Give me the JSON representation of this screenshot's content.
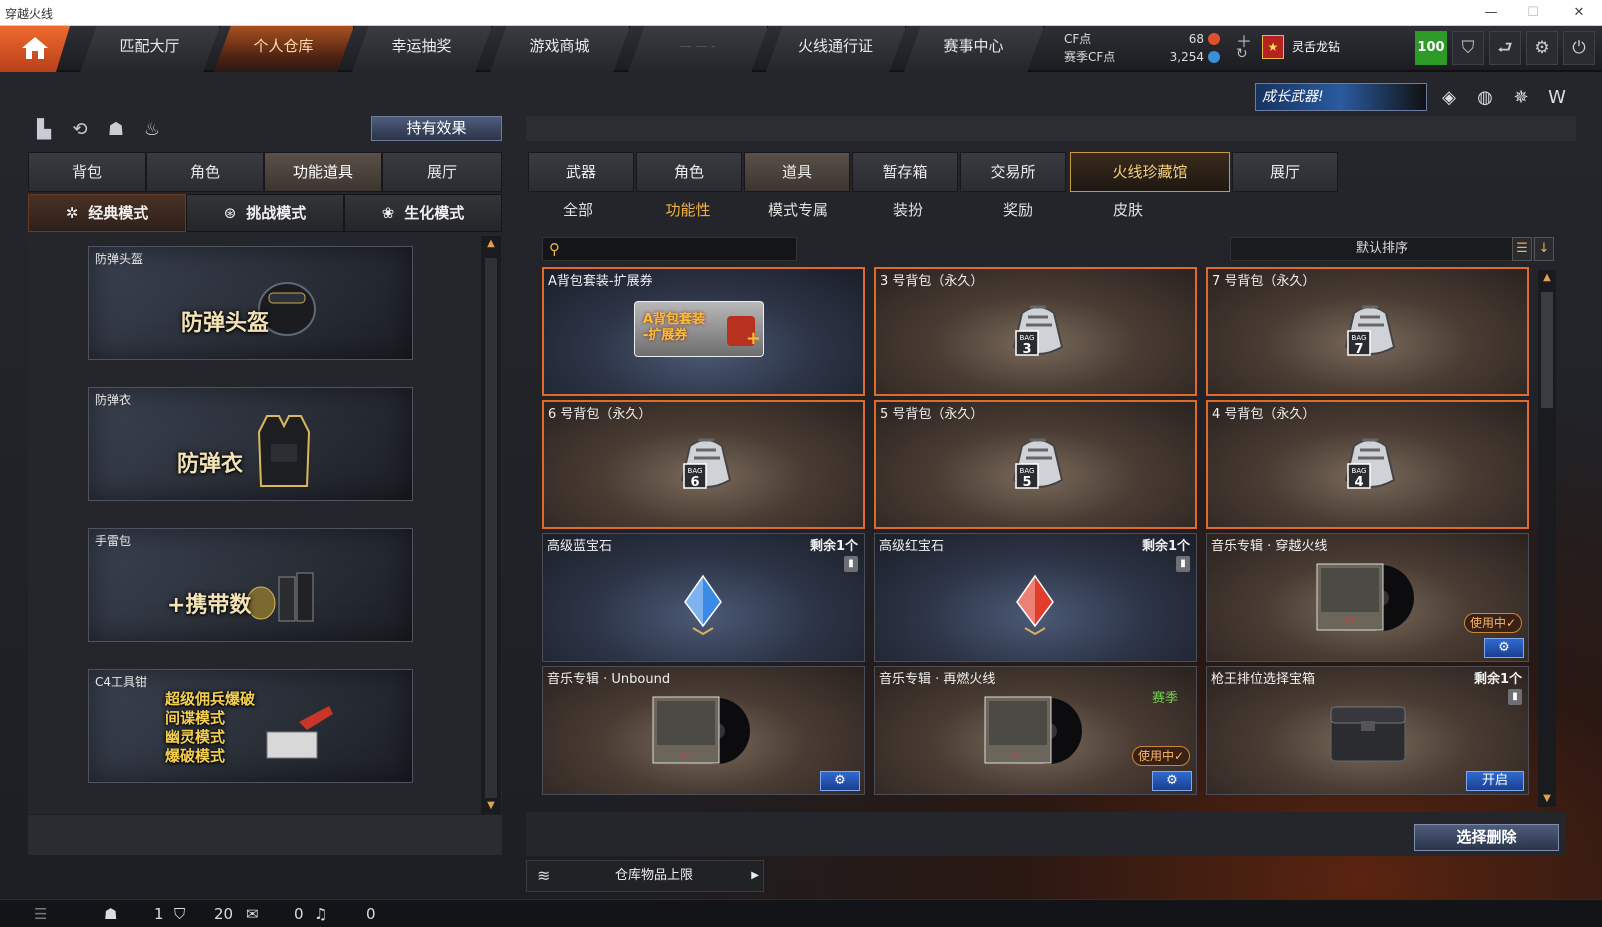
{
  "window": {
    "title": "穿越火线",
    "min": "—",
    "max": "☐",
    "close": "✕"
  },
  "nav": {
    "tabs": [
      "匹配大厅",
      "个人仓库",
      "幸运抽奖",
      "游戏商城",
      "— — -",
      "火线通行证",
      "赛事中心"
    ],
    "cf_label": "CF点",
    "cf_value": "68",
    "season_label": "赛季CF点",
    "season_value": "3,254",
    "username": "灵舌龙钻",
    "rank_icon": "rank-badge",
    "level": "100"
  },
  "effects_button": "持有效果",
  "banner_text": "成长武器!",
  "left": {
    "tabs": [
      "背包",
      "角色",
      "功能道具",
      "展厅"
    ],
    "active_tab": 2,
    "modes": [
      {
        "icon": "✲",
        "label": "经典模式"
      },
      {
        "icon": "⊛",
        "label": "挑战模式"
      },
      {
        "icon": "❀",
        "label": "生化模式"
      }
    ],
    "items": [
      {
        "label": "防弹头盔",
        "big": "防弹头盔"
      },
      {
        "label": "防弹衣",
        "big": "防弹衣"
      },
      {
        "label": "手雷包",
        "big": "+携带数"
      },
      {
        "label": "C4工具钳",
        "big": "超级佣兵爆破\n间谍模式\n幽灵模式\n爆破模式"
      }
    ]
  },
  "right": {
    "tabs": [
      "武器",
      "角色",
      "道具",
      "暂存箱",
      "交易所",
      "火线珍藏馆",
      "展厅"
    ],
    "active_tab": 2,
    "subtabs": [
      "全部",
      "功能性",
      "模式专属",
      "装扮",
      "奖励",
      "皮肤"
    ],
    "active_subtab": 1,
    "search_placeholder": "",
    "sort_label": "默认排序",
    "cards": [
      {
        "name": "A背包套装-扩展券",
        "type": "ticket",
        "art": "A背包套装\n-扩展券",
        "sel": true,
        "style": "blue"
      },
      {
        "name": "3 号背包（永久）",
        "type": "bag",
        "num": "3",
        "sel": true
      },
      {
        "name": "7 号背包（永久）",
        "type": "bag",
        "num": "7",
        "sel": true
      },
      {
        "name": "6 号背包（永久）",
        "type": "bag",
        "num": "6",
        "sel": true
      },
      {
        "name": "5 号背包（永久）",
        "type": "bag",
        "num": "5",
        "sel": true
      },
      {
        "name": "4 号背包（永久）",
        "type": "bag",
        "num": "4",
        "sel": true
      },
      {
        "name": "高级蓝宝石",
        "type": "gem",
        "color": "#3a8ae6",
        "remain": "剩余1个",
        "style": "blue"
      },
      {
        "name": "高级红宝石",
        "type": "gem",
        "color": "#e23c2c",
        "remain": "剩余1个",
        "style": "blue"
      },
      {
        "name": "音乐专辑 · 穿越火线",
        "type": "album",
        "inuse": "使用中✓",
        "gear": "⚙"
      },
      {
        "name": "音乐专辑 · Unbound",
        "type": "album",
        "gear": "⚙"
      },
      {
        "name": "音乐专辑 · 再燃火线",
        "type": "album",
        "season": "赛季",
        "inuse": "使用中✓",
        "gear": "⚙"
      },
      {
        "name": "枪王排位选择宝箱",
        "type": "box",
        "remain": "剩余1个",
        "open": "开启"
      }
    ],
    "select_delete": "选择删除",
    "capacity_label": "仓库物品上限"
  },
  "status": {
    "v1": "1",
    "v2": "20",
    "v3": "0",
    "v4": "0"
  }
}
